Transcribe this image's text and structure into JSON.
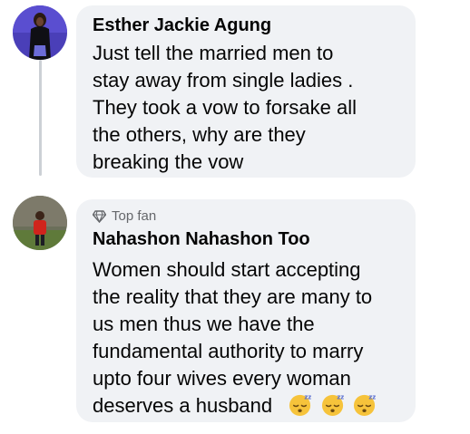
{
  "comments": [
    {
      "author": "Esther Jackie Agung",
      "avatar_icon": "profile-photo",
      "lines": [
        "Just tell the married men to",
        "stay away from single ladies .",
        "They took a vow to forsake all",
        "the others, why are they",
        "breaking the vow"
      ]
    },
    {
      "badge": "Top fan",
      "badge_icon": "diamond-icon",
      "author": "Nahashon Nahashon Too",
      "avatar_icon": "profile-photo",
      "lines": [
        "Women should start accepting",
        "the reality that they are many to",
        "us men thus we have the",
        "fundamental authority to marry",
        "upto four wives every woman",
        "deserves a husband"
      ],
      "trailing_emoji": [
        "sleeping-face",
        "sleeping-face",
        "sleeping-face"
      ]
    }
  ],
  "colors": {
    "bubble": "#f0f2f5",
    "text": "#050505",
    "secondary": "#65676b",
    "thread_line": "#ccd0d5"
  }
}
